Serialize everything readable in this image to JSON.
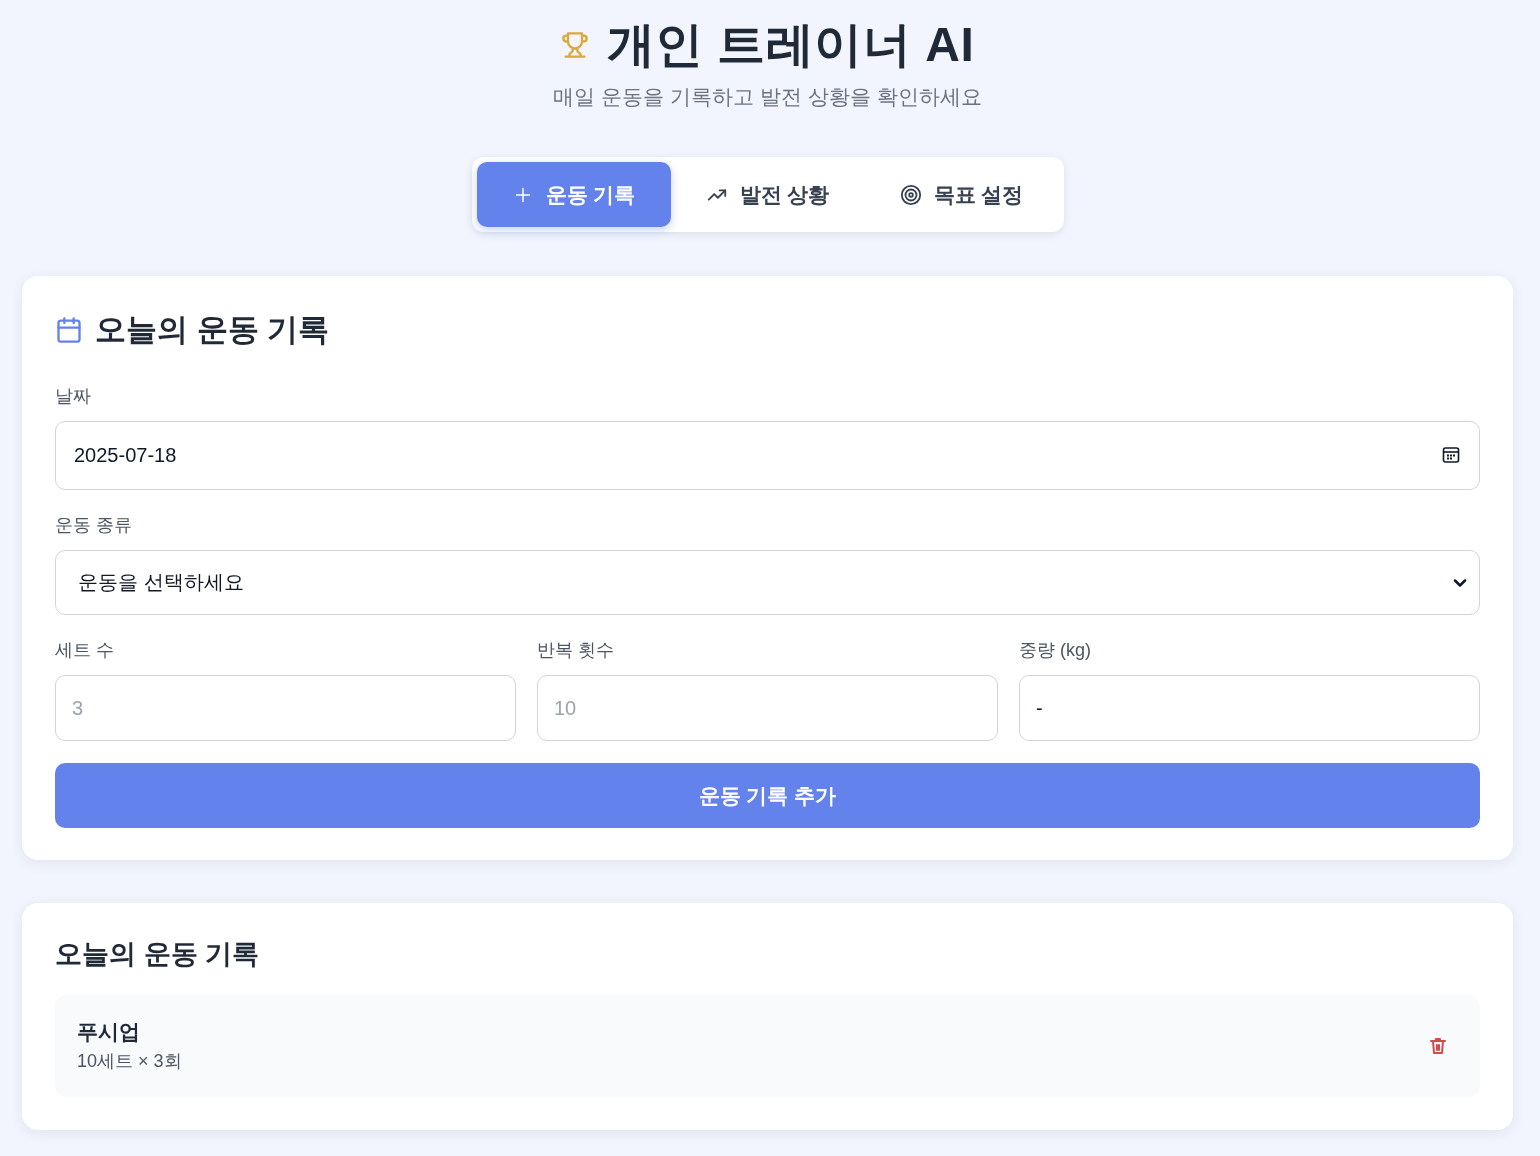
{
  "header": {
    "title": "개인 트레이너 AI",
    "subtitle": "매일 운동을 기록하고 발전 상황을 확인하세요"
  },
  "tabs": [
    {
      "label": "운동 기록",
      "selected": true
    },
    {
      "label": "발전 상황",
      "selected": false
    },
    {
      "label": "목표 설정",
      "selected": false
    }
  ],
  "log_form": {
    "title": "오늘의 운동 기록",
    "date_field": {
      "label": "날짜",
      "value": "2025-07-18"
    },
    "exercise_field": {
      "label": "운동 종류",
      "value": "운동을 선택하세요"
    },
    "detail_fields": [
      {
        "label": "세트 수",
        "placeholder": "3"
      },
      {
        "label": "반복 횟수",
        "placeholder": "10"
      },
      {
        "label": "중량 (kg)",
        "value": "-"
      }
    ],
    "submit_button": "운동 기록 추가"
  },
  "records": {
    "title": "오늘의 운동 기록",
    "items": [
      {
        "name": "푸시업",
        "detail": "10세트 × 3회"
      }
    ]
  }
}
